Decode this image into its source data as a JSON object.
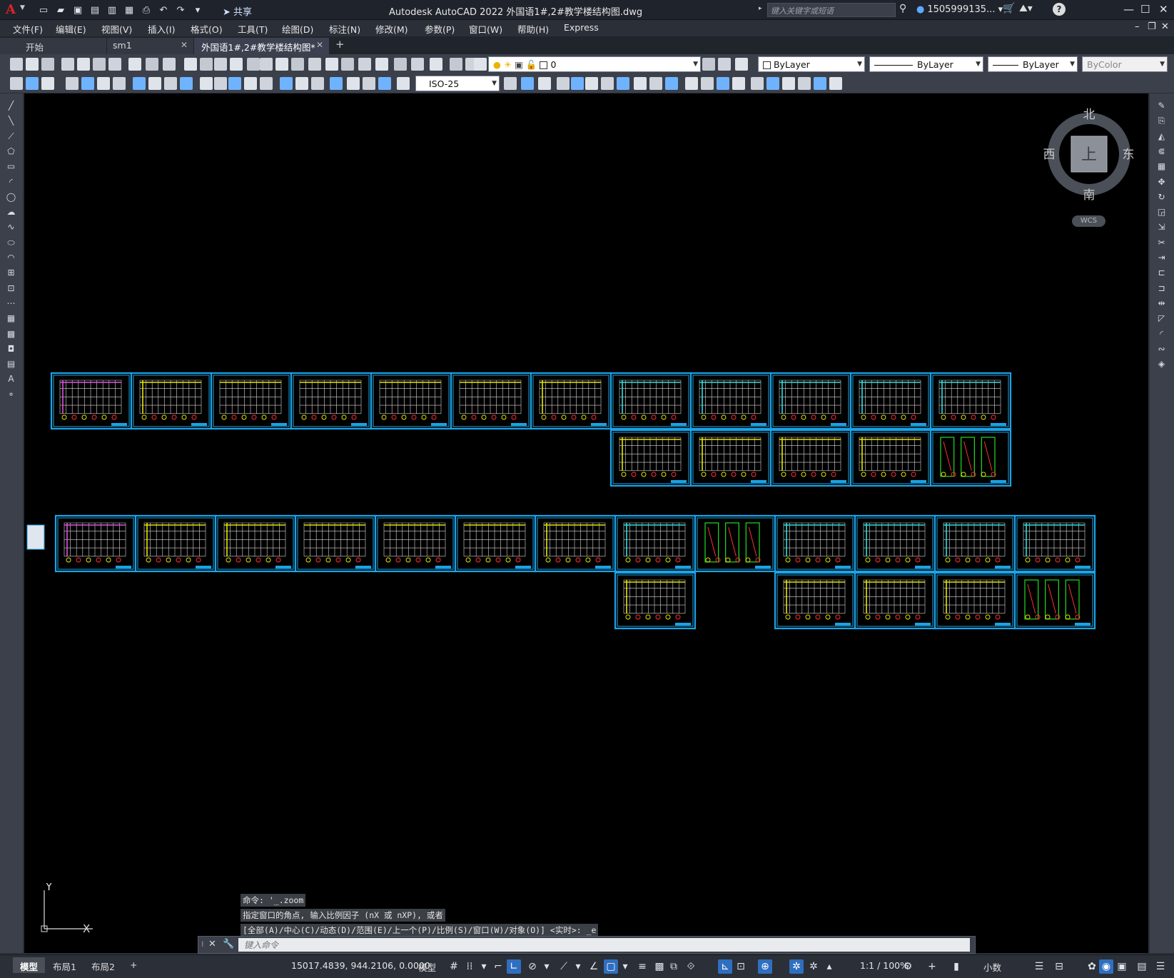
{
  "app": {
    "title": "Autodesk AutoCAD 2022    外国语1#,2#教学楼结构图.dwg",
    "share_label": "共享",
    "search_placeholder": "键入关键字或短语",
    "user": "1505999135...",
    "help": "?"
  },
  "menu": [
    "文件(F)",
    "编辑(E)",
    "视图(V)",
    "插入(I)",
    "格式(O)",
    "工具(T)",
    "绘图(D)",
    "标注(N)",
    "修改(M)",
    "参数(P)",
    "窗口(W)",
    "帮助(H)",
    "Express"
  ],
  "tabs": [
    {
      "label": "开始",
      "active": false,
      "closable": false
    },
    {
      "label": "sm1",
      "active": false,
      "closable": true
    },
    {
      "label": "外国语1#,2#教学楼结构图*",
      "active": true,
      "closable": true
    }
  ],
  "toolbar": {
    "layer_value": "0",
    "color_value": "ByLayer",
    "linetype_value": "ByLayer",
    "lineweight_value": "ByLayer",
    "plotstyle_value": "ByColor",
    "dimstyle_value": "ISO-25"
  },
  "viewcube": {
    "north": "北",
    "south": "南",
    "east": "东",
    "west": "西",
    "face": "上",
    "wcs": "WCS"
  },
  "ucs": {
    "x": "X",
    "y": "Y"
  },
  "command": {
    "history": [
      "命令: '_.zoom",
      "指定窗口的角点, 输入比例因子 (nX 或 nXP), 或者",
      "[全部(A)/中心(C)/动态(D)/范围(E)/上一个(P)/比例(S)/窗口(W)/对象(O)] <实时>: _e"
    ],
    "placeholder": "键入命令"
  },
  "status": {
    "layout_tabs": [
      "模型",
      "布局1",
      "布局2"
    ],
    "coords": "15017.4839, 944.2106, 0.0000",
    "space": "模型",
    "scale": "1:1 / 100%",
    "units": "小数"
  },
  "drawing": {
    "colors": {
      "frame": "#1aa3e6",
      "grid": "#d8d8d8",
      "magenta": "#e052e0",
      "yellow": "#e6e600",
      "cyan": "#2fe0e0",
      "green": "#22dd22",
      "red": "#ff3030"
    }
  }
}
